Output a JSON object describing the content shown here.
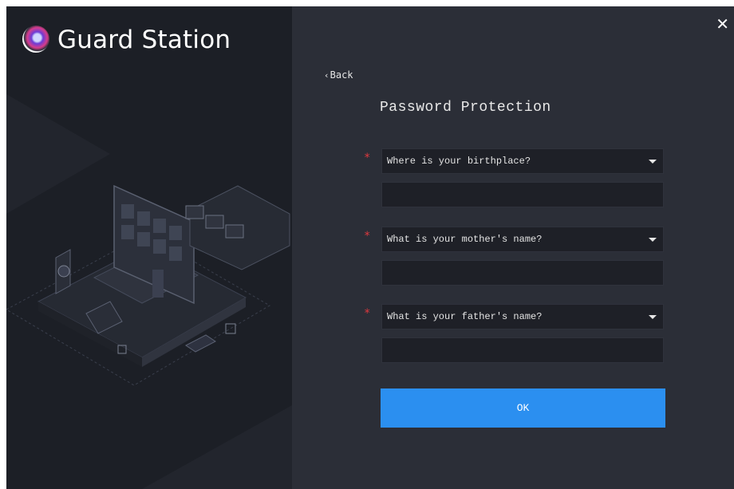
{
  "app": {
    "title": "Guard Station"
  },
  "window": {
    "close_glyph": "✕"
  },
  "nav": {
    "back_label": "Back",
    "back_icon": "chevron-left-icon"
  },
  "form": {
    "heading": "Password Protection",
    "required_mark": "*",
    "questions": [
      {
        "selected": "Where is your birthplace?",
        "answer": ""
      },
      {
        "selected": "What is your mother's name?",
        "answer": ""
      },
      {
        "selected": "What is your father's name?",
        "answer": ""
      }
    ],
    "ok_label": "OK"
  },
  "colors": {
    "left_panel": "#1c1f26",
    "right_panel": "#2b2e37",
    "field_bg": "#1e2027",
    "accent": "#2b8ff0",
    "required": "#e0383e"
  }
}
